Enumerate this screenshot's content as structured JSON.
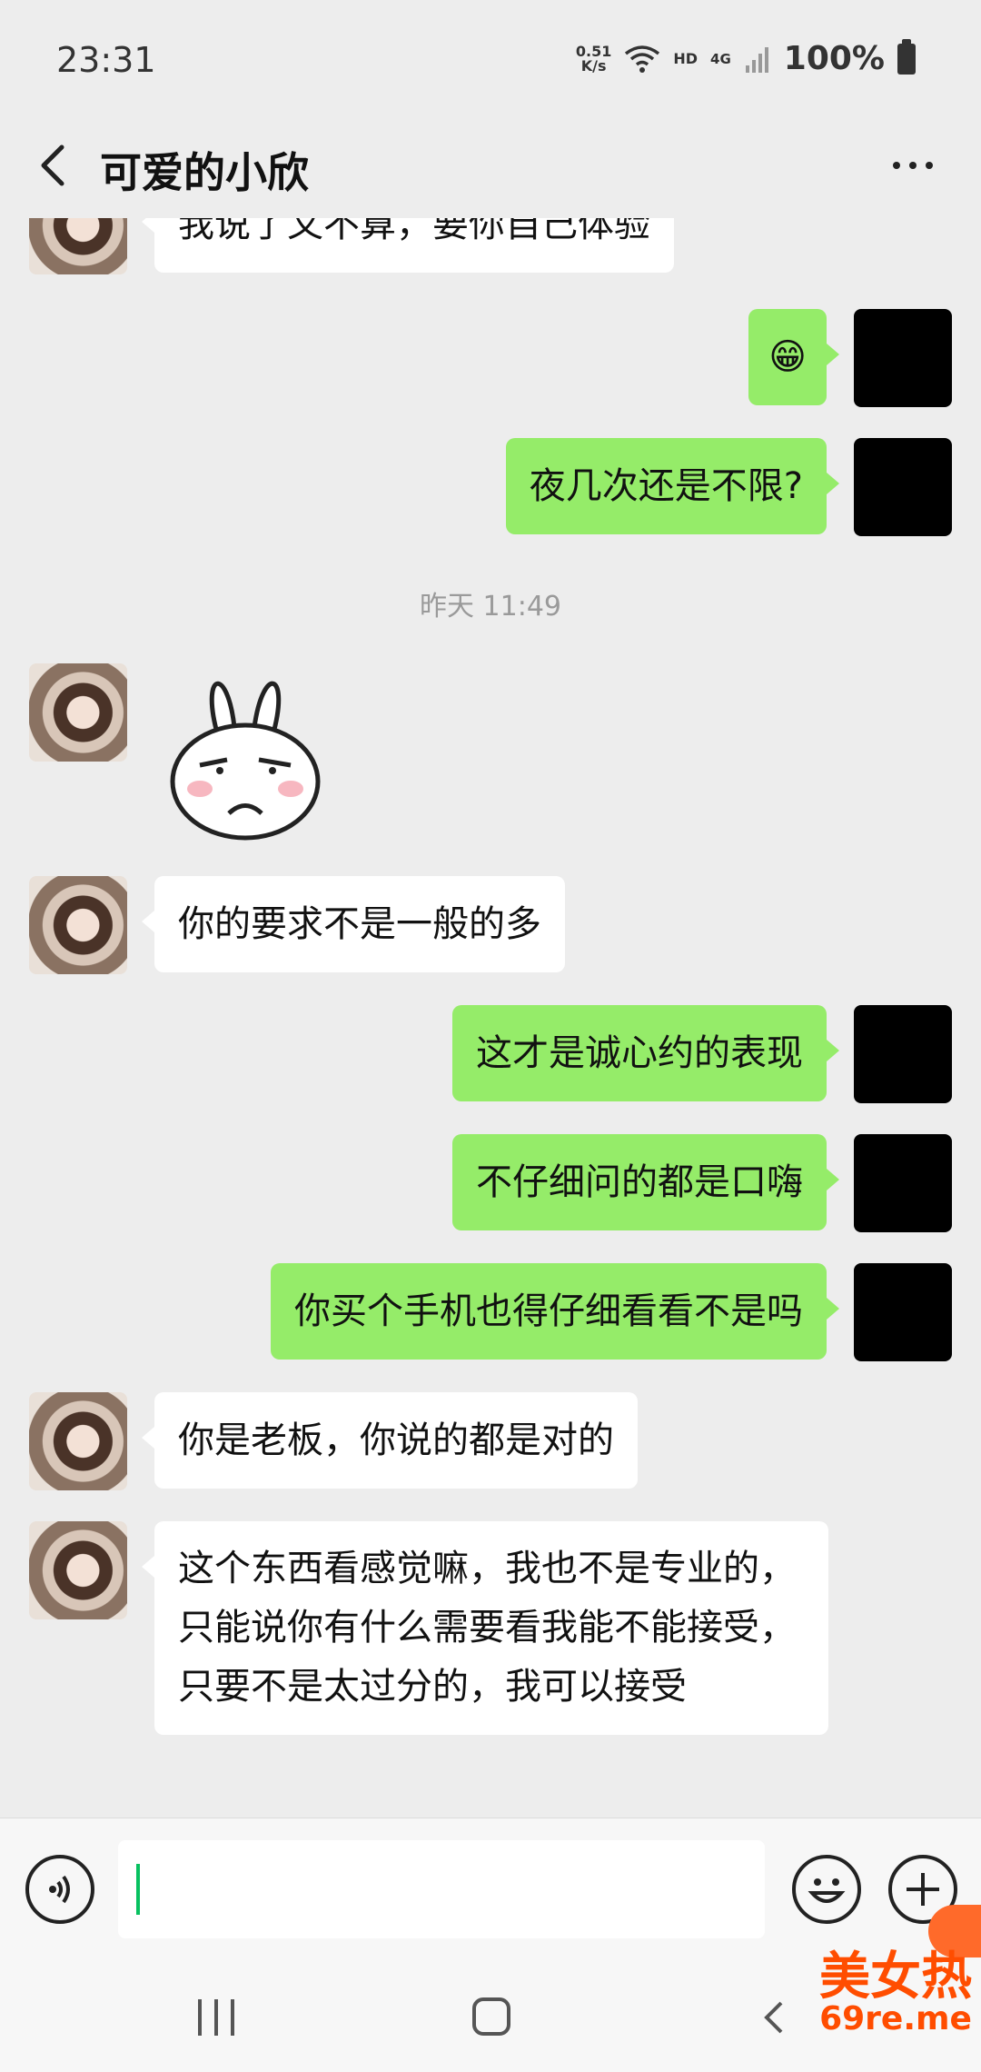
{
  "status_bar": {
    "time": "23:31",
    "net_speed_value": "0.51",
    "net_speed_unit": "K/s",
    "hd": "HD",
    "network": "4G",
    "battery": "100%"
  },
  "header": {
    "title": "可爱的小欣"
  },
  "messages": [
    {
      "from": "other",
      "text": "我说了又不算，要你自己体验"
    },
    {
      "from": "me",
      "text": "😁"
    },
    {
      "from": "me",
      "text": "夜几次还是不限?"
    },
    {
      "from": "system",
      "text": "昨天 11:49"
    },
    {
      "from": "other",
      "sticker": "rabbit-sticker"
    },
    {
      "from": "other",
      "text": "你的要求不是一般的多"
    },
    {
      "from": "me",
      "text": "这才是诚心约的表现"
    },
    {
      "from": "me",
      "text": "不仔细问的都是口嗨"
    },
    {
      "from": "me",
      "text": "你买个手机也得仔细看看不是吗"
    },
    {
      "from": "other",
      "text": "你是老板，你说的都是对的"
    },
    {
      "from": "other",
      "text": "这个东西看感觉嘛，我也不是专业的，只能说你有什么需要看我能不能接受，只要不是太过分的，我可以接受"
    }
  ],
  "input": {
    "value": ""
  },
  "watermark": {
    "cn": "美女热",
    "url": "69re.me"
  },
  "colors": {
    "my_bubble": "#95ec69",
    "other_bubble": "#ffffff",
    "background": "#ededed",
    "caret": "#07c160"
  }
}
